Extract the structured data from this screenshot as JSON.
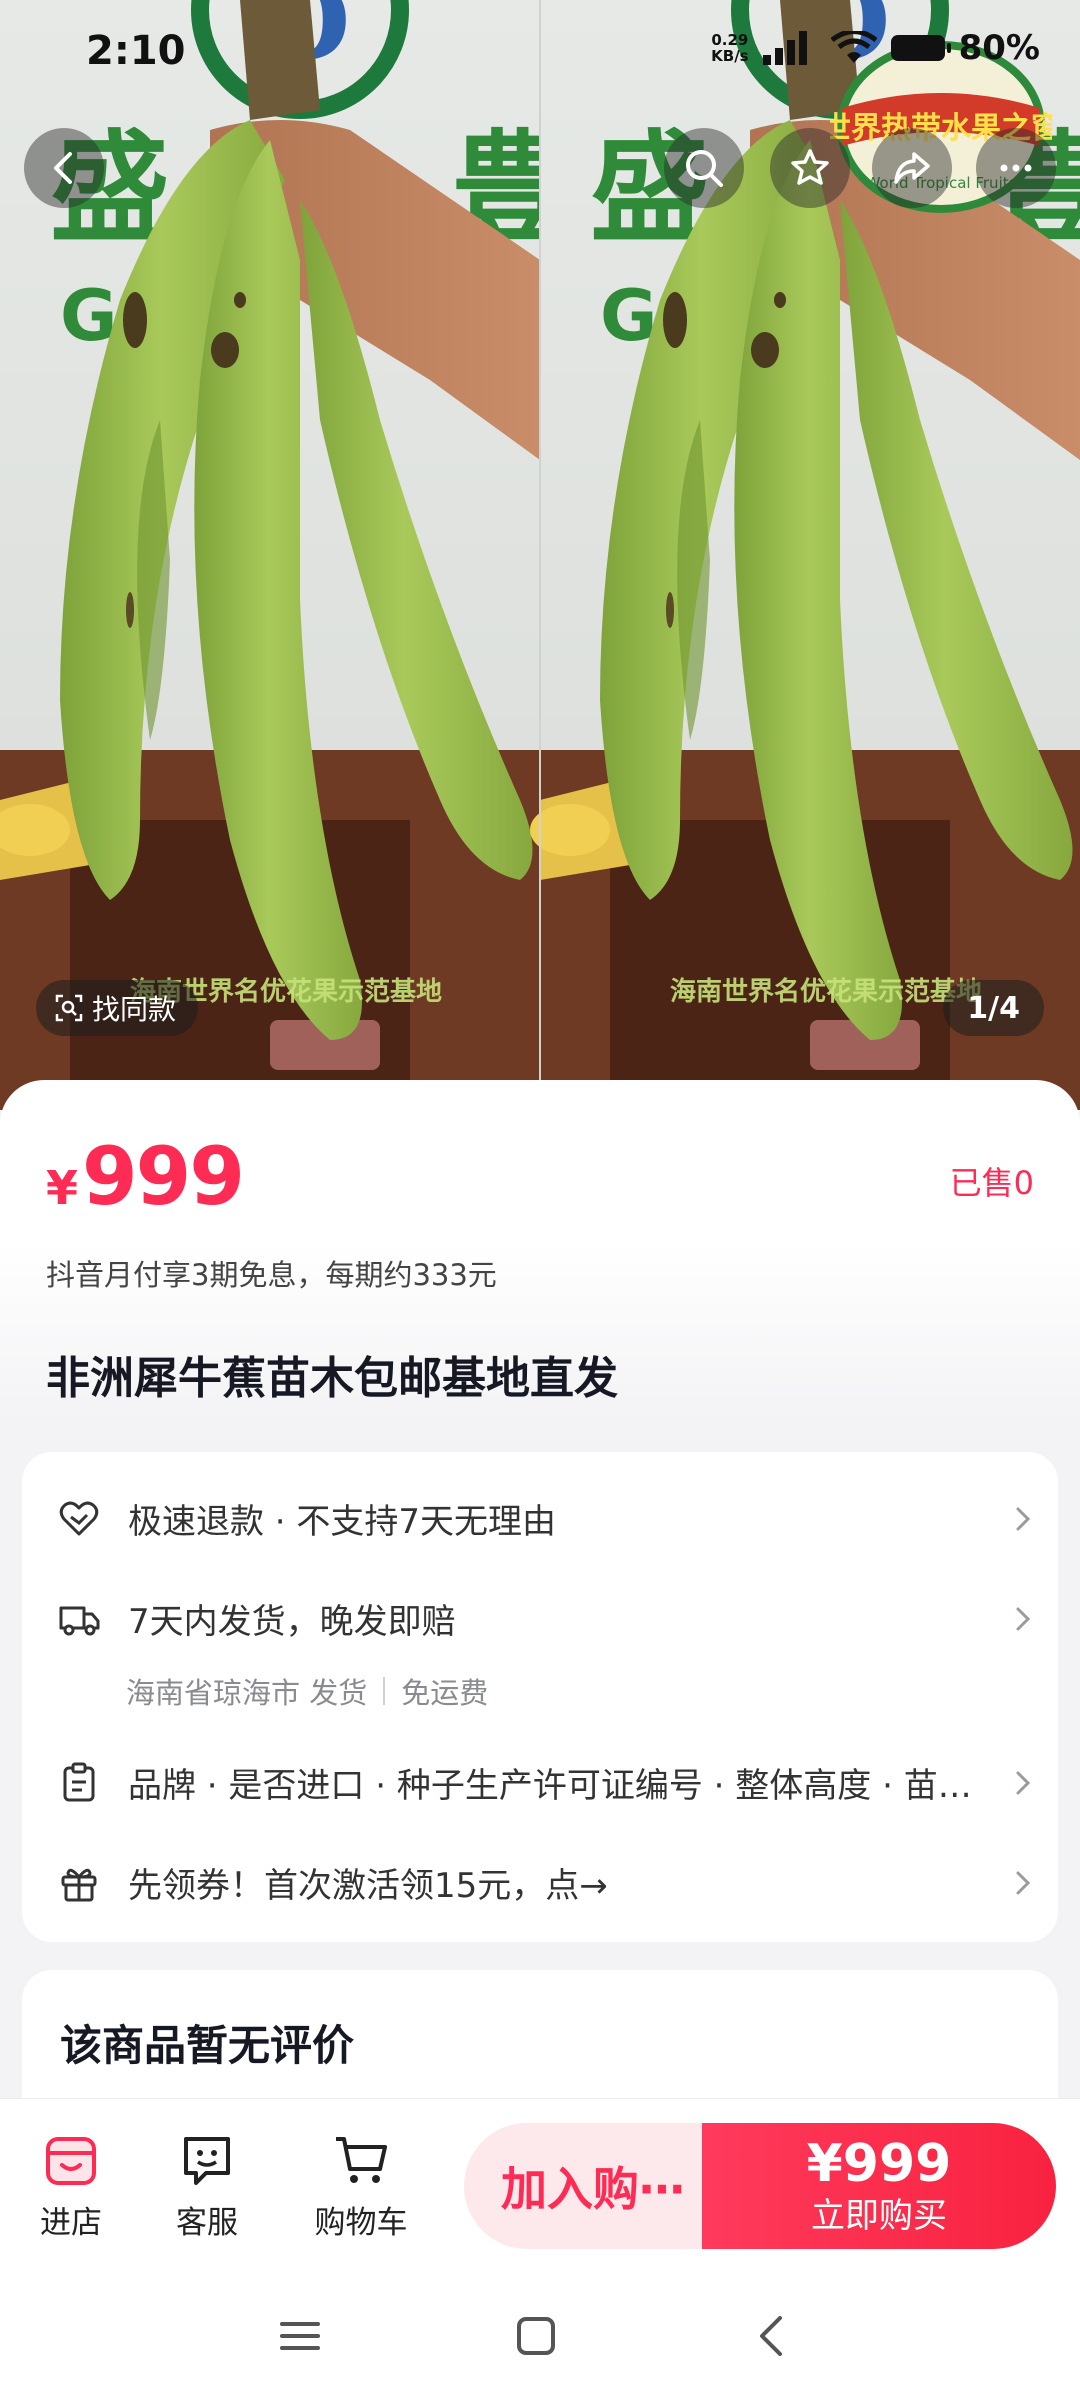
{
  "status_bar": {
    "time": "2:10",
    "net_speed_value": "0.29",
    "net_speed_unit": "KB/s",
    "battery": "80%"
  },
  "gallery": {
    "find_same_label": "找同款",
    "page_indicator": "1/4",
    "watermark_text": "海南世界名优花果示范基地",
    "badge_text": "世界热带水果之窗",
    "badge_subtext": "World Tropical Fruits"
  },
  "product": {
    "currency": "¥",
    "price": "999",
    "sold": "已售0",
    "installment": "抖音月付享3期免息，每期约333元",
    "title": "非洲犀牛蕉苗木包邮基地直发"
  },
  "services": [
    {
      "icon": "refund-heart-icon",
      "text": "极速退款 · 不支持7天无理由"
    },
    {
      "icon": "delivery-truck-icon",
      "text": "7天内发货，晚发即赔"
    },
    {
      "icon": "clipboard-icon",
      "text": "品牌 · 是否进口 · 种子生产许可证编号 · 整体高度 · 苗木规格"
    },
    {
      "icon": "gift-icon",
      "text": "先领券！首次激活领15元，点→"
    }
  ],
  "shipping": {
    "origin": "海南省琼海市 发货",
    "fee": "免运费"
  },
  "reviews": {
    "title": "该商品暂无评价"
  },
  "action_bar": {
    "shop_label": "进店",
    "service_label": "客服",
    "cart_label": "购物车",
    "add_to_cart_label": "加入购⋯",
    "buy_price": "¥999",
    "buy_label": "立即购买"
  },
  "colors": {
    "accent": "#fe2c55"
  }
}
